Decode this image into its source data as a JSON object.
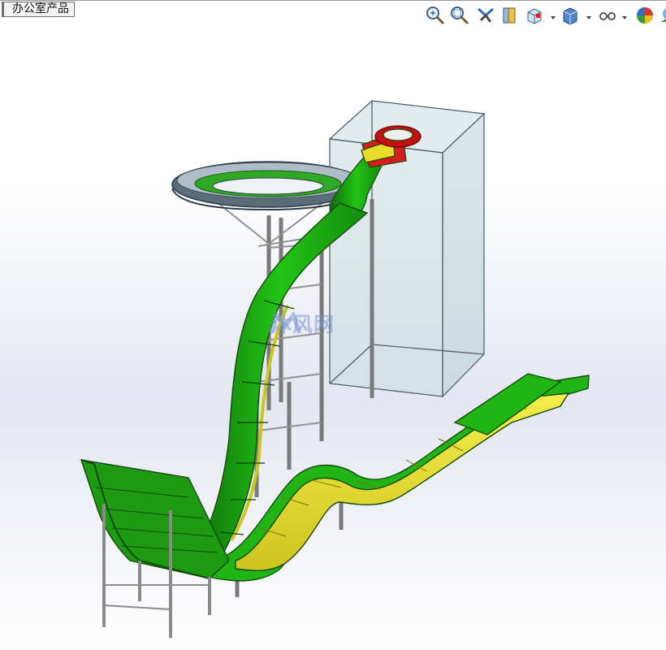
{
  "window": {
    "document_tab": "办公室产品"
  },
  "toolbar": {
    "tools": [
      {
        "name": "zoom-to-fit",
        "icon": "zoom-fit-icon"
      },
      {
        "name": "zoom-to-area",
        "icon": "zoom-area-icon"
      },
      {
        "name": "previous-view",
        "icon": "previous-view-icon"
      },
      {
        "name": "section-view",
        "icon": "section-view-icon"
      },
      {
        "name": "view-orientation",
        "icon": "view-orientation-icon"
      },
      {
        "name": "display-style",
        "icon": "display-style-icon"
      },
      {
        "name": "hide-show-items",
        "icon": "hide-show-icon"
      },
      {
        "name": "edit-appearance",
        "icon": "appearance-icon"
      },
      {
        "name": "apply-scene",
        "icon": "scene-icon"
      }
    ]
  },
  "viewport": {
    "watermark": "沐风网",
    "colors": {
      "slide_green": "#1fb512",
      "slide_yellow": "#e8e02a",
      "slide_red": "#d41a1a",
      "tower": "#cfdde0"
    }
  }
}
